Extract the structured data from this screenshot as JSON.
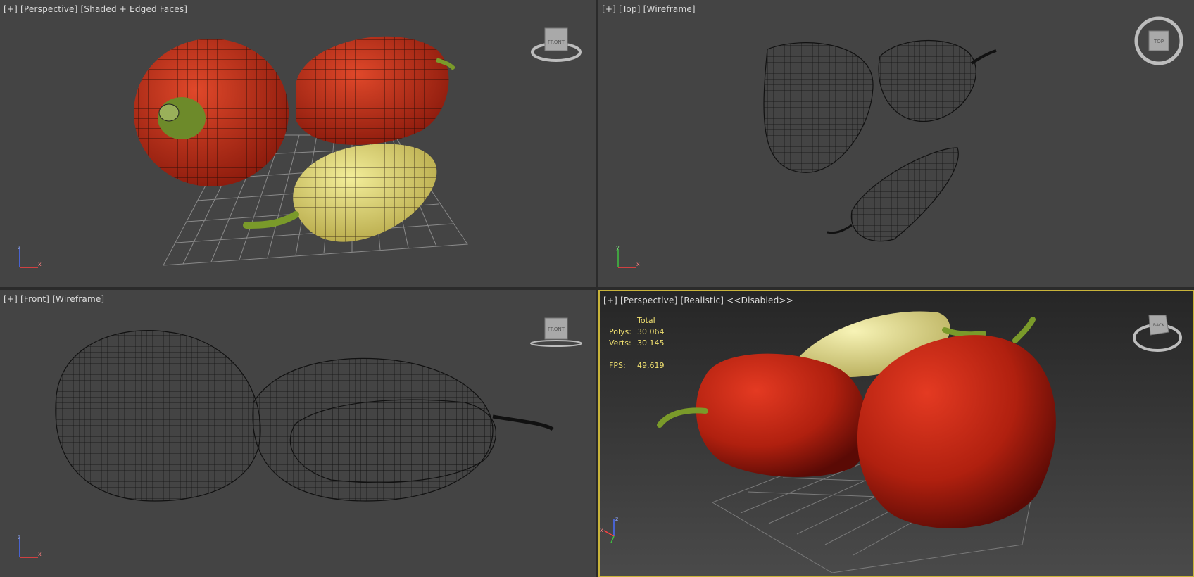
{
  "viewports": {
    "top_left": {
      "label_parts": [
        "[+]",
        "[Perspective]",
        "[Shaded + Edged Faces]"
      ],
      "navcube_face": "FRONT",
      "axis": {
        "up": "z",
        "right": "x"
      }
    },
    "top_right": {
      "label_parts": [
        "[+]",
        "[Top]",
        "[Wireframe]"
      ],
      "navcube_face": "TOP",
      "axis": {
        "up": "y",
        "right": "x"
      }
    },
    "bottom_left": {
      "label_parts": [
        "[+]",
        "[Front]",
        "[Wireframe]"
      ],
      "navcube_face": "FRONT",
      "axis": {
        "up": "z",
        "right": "x"
      }
    },
    "bottom_right": {
      "label_parts": [
        "[+]",
        "[Perspective]",
        "[Realistic]",
        "<<Disabled>>"
      ],
      "navcube_face": "BACK",
      "axis": {
        "up": "z",
        "right": "x",
        "down": "y"
      },
      "stats": {
        "header": "Total",
        "polys_label": "Polys:",
        "polys_value": "30 064",
        "verts_label": "Verts:",
        "verts_value": "30 145",
        "fps_label": "FPS:",
        "fps_value": "49,619"
      }
    }
  },
  "colors": {
    "viewport_bg": "#444444",
    "active_border": "#c9b43a",
    "stats_text": "#f0e070",
    "red_pepper": "#c0281a",
    "yellow_pepper": "#e6e07a",
    "stem": "#7a9a2a"
  }
}
